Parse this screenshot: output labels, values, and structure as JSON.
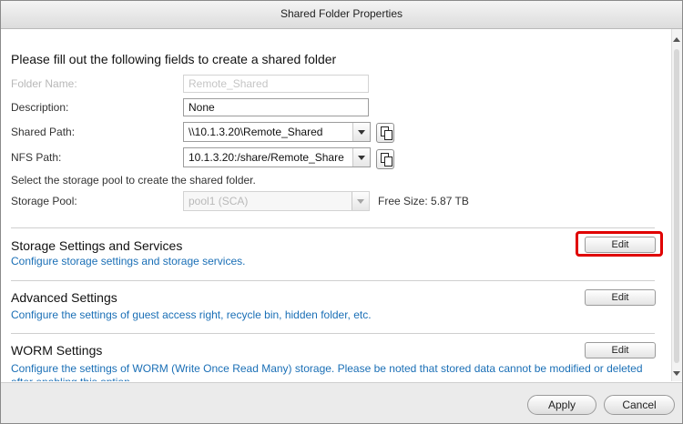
{
  "window": {
    "title": "Shared Folder Properties"
  },
  "form": {
    "heading": "Please fill out the following fields to create a shared folder",
    "folder_name": {
      "label": "Folder Name:",
      "value": "Remote_Shared"
    },
    "description": {
      "label": "Description:",
      "value": "None"
    },
    "shared_path": {
      "label": "Shared Path:",
      "value": "\\\\10.1.3.20\\Remote_Shared"
    },
    "nfs_path": {
      "label": "NFS Path:",
      "value": "10.1.3.20:/share/Remote_Share"
    },
    "pool_hint": "Select the storage pool to create the shared folder.",
    "storage_pool": {
      "label": "Storage Pool:",
      "value": "pool1 (SCA)"
    },
    "free_size": "Free Size: 5.87 TB",
    "copy_icon": "copy-icon"
  },
  "sections": [
    {
      "title": "Storage Settings and Services",
      "description": "Configure storage settings and storage services.",
      "button": "Edit"
    },
    {
      "title": "Advanced Settings",
      "description": "Configure the settings of guest access right, recycle bin, hidden folder, etc.",
      "button": "Edit"
    },
    {
      "title": "WORM Settings",
      "description": "Configure the settings of WORM (Write Once Read Many) storage. Please be noted that stored data cannot be modified or deleted after enabling this option.",
      "button": "Edit"
    }
  ],
  "highlight_color": "#e00000",
  "link_color": "#1a6fb6",
  "footer": {
    "apply": "Apply",
    "cancel": "Cancel"
  }
}
